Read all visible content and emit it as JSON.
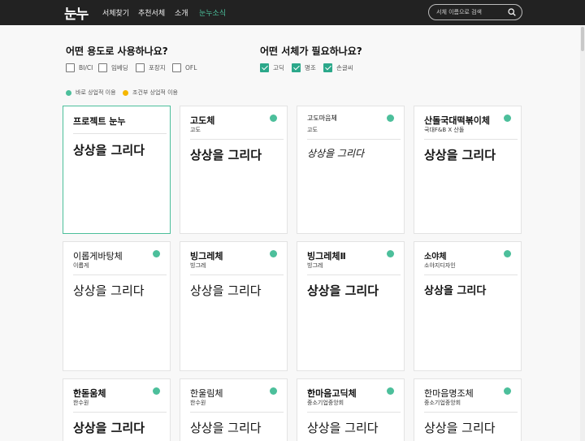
{
  "header": {
    "logo": "눈누",
    "nav": [
      {
        "label": "서체찾기"
      },
      {
        "label": "추천서체"
      },
      {
        "label": "소개"
      },
      {
        "label": "눈누소식"
      }
    ],
    "search_placeholder": "서체 이름으로 검색"
  },
  "filters": {
    "usage_title": "어떤 용도로 사용하나요?",
    "usage_options": [
      {
        "label": "BI/CI",
        "checked": false
      },
      {
        "label": "임베딩",
        "checked": false
      },
      {
        "label": "포장지",
        "checked": false
      },
      {
        "label": "OFL",
        "checked": false
      }
    ],
    "style_title": "어떤 서체가 필요하나요?",
    "style_options": [
      {
        "label": "고딕",
        "checked": true
      },
      {
        "label": "명조",
        "checked": true
      },
      {
        "label": "손글씨",
        "checked": true
      }
    ]
  },
  "legend": {
    "immediate": "바로 상업적 이용",
    "conditional": "조건부 상업적 이용",
    "green": "#4cbf9b",
    "yellow": "#f5b700"
  },
  "cards": [
    {
      "name": "프로젝트 눈누",
      "maker": "",
      "sample": "상상을 그리다",
      "dot": false
    },
    {
      "name": "고도체",
      "maker": "고도",
      "sample": "상상을 그리다",
      "dot": true
    },
    {
      "name": "고도마음체",
      "maker": "고도",
      "sample": "상상을 그리다",
      "dot": true
    },
    {
      "name": "산돌국대떡볶이체",
      "maker": "국대F&B X 산돌",
      "sample": "상상을 그리다",
      "dot": true
    },
    {
      "name": "이롭게바탕체",
      "maker": "이롭게",
      "sample": "상상을 그리다",
      "dot": true
    },
    {
      "name": "빙그레체",
      "maker": "빙그레",
      "sample": "상상을 그리다",
      "dot": true
    },
    {
      "name": "빙그레체Ⅱ",
      "maker": "빙그레",
      "sample": "상상을 그리다",
      "dot": true
    },
    {
      "name": "소야체",
      "maker": "소야지디자인",
      "sample": "상상을 그리다",
      "dot": true
    },
    {
      "name": "한돋움체",
      "maker": "한수원",
      "sample": "상상을 그리다",
      "dot": true
    },
    {
      "name": "한울림체",
      "maker": "한수원",
      "sample": "상상을 그리다",
      "dot": true
    },
    {
      "name": "한마음고딕체",
      "maker": "중소기업중앙회",
      "sample": "상상을 그리다",
      "dot": true
    },
    {
      "name": "한마음명조체",
      "maker": "중소기업중앙회",
      "sample": "상상을 그리다",
      "dot": true
    }
  ]
}
